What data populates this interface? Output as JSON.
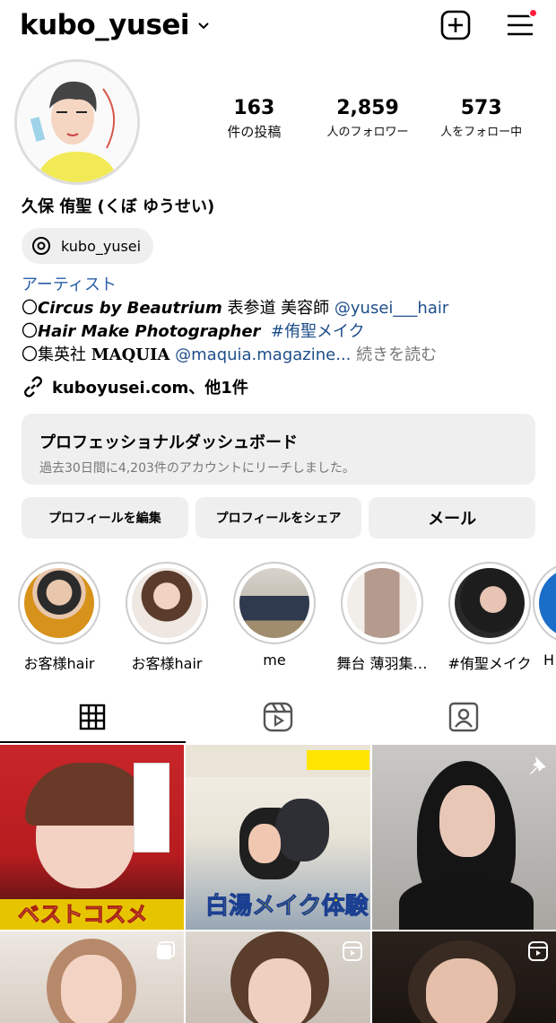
{
  "header": {
    "username": "kubo_yusei",
    "accent_color": "#ff1f3d",
    "icons": [
      "chevron-down-icon",
      "create-plus-icon",
      "menu-icon"
    ]
  },
  "stats": [
    {
      "value": "163",
      "label": "件の投稿"
    },
    {
      "value": "2,859",
      "label": "人のフォロワー"
    },
    {
      "value": "573",
      "label": "人をフォロー中"
    }
  ],
  "profile": {
    "full_name": "久保 侑聖 (くぼ ゆうせい)",
    "threads_handle": "kubo_yusei",
    "category": "アーティスト",
    "bio_line1_prefix": "〇",
    "bio_line1_bold": "Circus by Beautrium",
    "bio_line1_text": " 表参道 美容師 ",
    "bio_line1_link": "@yusei___hair",
    "bio_line2_prefix": "〇",
    "bio_line2_bold": "Hair Make Photographer",
    "bio_line2_link": "#侑聖メイク",
    "bio_line3_prefix": "〇集英社",
    "bio_line3_brand": "MAQUIA",
    "bio_line3_link": "@maquia.magazine...",
    "bio_more": "続きを読む",
    "website": "kuboyusei.com、他1件"
  },
  "dashboard": {
    "title": "プロフェッショナルダッシュボード",
    "subtitle": "過去30日間に4,203件のアカウントにリーチしました。"
  },
  "actions": {
    "edit": "プロフィールを編集",
    "share": "プロフィールをシェア",
    "mail": "メール"
  },
  "highlights": [
    {
      "label": "お客様hair"
    },
    {
      "label": "お客様hair"
    },
    {
      "label": "me"
    },
    {
      "label": "舞台 薄羽集…"
    },
    {
      "label": "#侑聖メイク"
    },
    {
      "label": "H"
    }
  ],
  "tabs": [
    "grid-icon",
    "reels-icon",
    "tagged-icon"
  ],
  "posts": [
    {
      "text": "ベストコスメ"
    },
    {
      "text": "白湯メイク体験"
    },
    {
      "text": ""
    }
  ]
}
